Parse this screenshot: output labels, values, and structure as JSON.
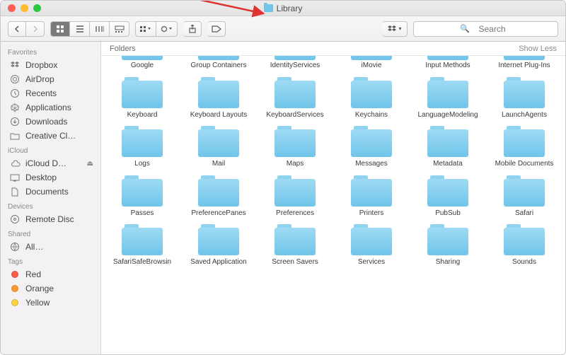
{
  "window": {
    "title": "Library"
  },
  "toolbar": {
    "dropbox": "Dropbox",
    "search_placeholder": "Search"
  },
  "content_header": {
    "label": "Folders",
    "toggle": "Show Less"
  },
  "sidebar": {
    "sections": [
      {
        "title": "Favorites",
        "items": [
          {
            "icon": "dropbox",
            "label": "Dropbox"
          },
          {
            "icon": "airdrop",
            "label": "AirDrop"
          },
          {
            "icon": "recents",
            "label": "Recents"
          },
          {
            "icon": "apps",
            "label": "Applications"
          },
          {
            "icon": "downloads",
            "label": "Downloads"
          },
          {
            "icon": "folder",
            "label": "Creative Cl…"
          }
        ]
      },
      {
        "title": "iCloud",
        "items": [
          {
            "icon": "icloud",
            "label": "iCloud D…",
            "eject": true
          },
          {
            "icon": "desktop",
            "label": "Desktop"
          },
          {
            "icon": "documents",
            "label": "Documents"
          }
        ]
      },
      {
        "title": "Devices",
        "items": [
          {
            "icon": "disc",
            "label": "Remote Disc"
          }
        ]
      },
      {
        "title": "Shared",
        "items": [
          {
            "icon": "network",
            "label": "All…"
          }
        ]
      },
      {
        "title": "Tags",
        "items": [
          {
            "icon": "tag",
            "label": "Red",
            "color": "#ff5b4f"
          },
          {
            "icon": "tag",
            "label": "Orange",
            "color": "#ff9a2e"
          },
          {
            "icon": "tag",
            "label": "Yellow",
            "color": "#ffd23f"
          }
        ]
      }
    ]
  },
  "folders": {
    "truncated_row": [
      "Google",
      "Group Containers",
      "IdentityServices",
      "iMovie",
      "Input Methods",
      "Internet Plug-Ins"
    ],
    "rows": [
      [
        "Keyboard",
        "Keyboard Layouts",
        "KeyboardServices",
        "Keychains",
        "LanguageModeling",
        "LaunchAgents"
      ],
      [
        "Logs",
        "Mail",
        "Maps",
        "Messages",
        "Metadata",
        "Mobile Documents"
      ],
      [
        "Passes",
        "PreferencePanes",
        "Preferences",
        "Printers",
        "PubSub",
        "Safari"
      ],
      [
        "SafariSafeBrowsin",
        "Saved Application",
        "Screen Savers",
        "Services",
        "Sharing",
        "Sounds"
      ]
    ]
  }
}
